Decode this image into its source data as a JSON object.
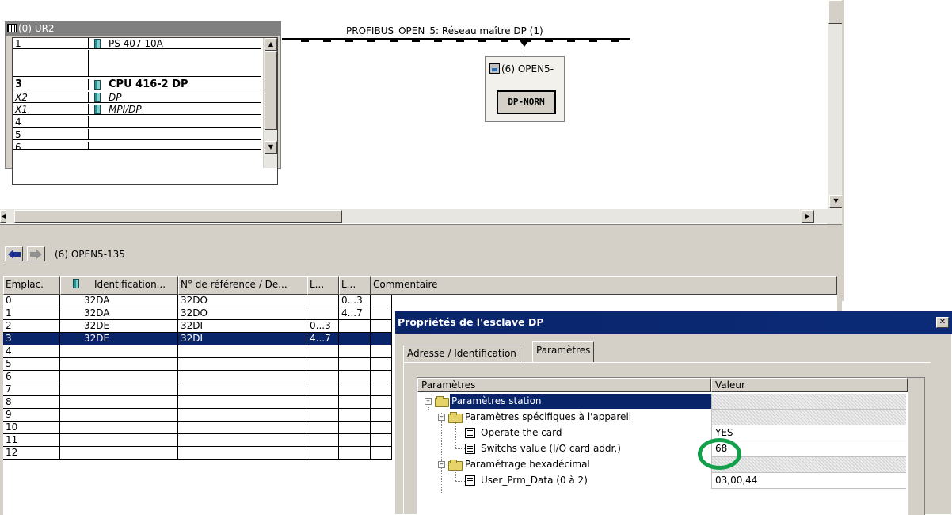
{
  "rack": {
    "title": "(0) UR2",
    "rows": [
      {
        "slot": "1",
        "module": "PS 407 10A",
        "style": "normal"
      },
      {
        "slot": "",
        "module": "",
        "style": "normal"
      },
      {
        "slot": "3",
        "module": "CPU 416-2 DP",
        "style": "bold"
      },
      {
        "slot": "X2",
        "module": "DP",
        "style": "italic"
      },
      {
        "slot": "X1",
        "module": "MPI/DP",
        "style": "italic"
      },
      {
        "slot": "4",
        "module": "",
        "style": "normal"
      },
      {
        "slot": "5",
        "module": "",
        "style": "normal"
      },
      {
        "slot": "6",
        "module": "",
        "style": "normal"
      }
    ]
  },
  "network": {
    "bus_label": "PROFIBUS_OPEN_5: Réseau maître DP (1)",
    "slave_label": "(6) OPEN5-",
    "slave_button": "DP-NORM"
  },
  "detail": {
    "station_label": "(6)  OPEN5-135",
    "columns": [
      "Emplac.",
      "Identification...",
      "N° de référence / De...",
      "L...",
      "L...",
      "Commentaire"
    ],
    "rows": [
      {
        "slot": "0",
        "id": "32DA",
        "ref": "32DO",
        "l1": "",
        "l2": "0...3",
        "comment": ""
      },
      {
        "slot": "1",
        "id": "32DA",
        "ref": "32DO",
        "l1": "",
        "l2": "4...7",
        "comment": ""
      },
      {
        "slot": "2",
        "id": "32DE",
        "ref": "32DI",
        "l1": "0...3",
        "l2": "",
        "comment": ""
      },
      {
        "slot": "3",
        "id": "32DE",
        "ref": "32DI",
        "l1": "4...7",
        "l2": "",
        "comment": ""
      },
      {
        "slot": "4",
        "id": "",
        "ref": "",
        "l1": "",
        "l2": "",
        "comment": ""
      },
      {
        "slot": "5",
        "id": "",
        "ref": "",
        "l1": "",
        "l2": "",
        "comment": ""
      },
      {
        "slot": "6",
        "id": "",
        "ref": "",
        "l1": "",
        "l2": "",
        "comment": ""
      },
      {
        "slot": "7",
        "id": "",
        "ref": "",
        "l1": "",
        "l2": "",
        "comment": ""
      },
      {
        "slot": "8",
        "id": "",
        "ref": "",
        "l1": "",
        "l2": "",
        "comment": ""
      },
      {
        "slot": "9",
        "id": "",
        "ref": "",
        "l1": "",
        "l2": "",
        "comment": ""
      },
      {
        "slot": "10",
        "id": "",
        "ref": "",
        "l1": "",
        "l2": "",
        "comment": ""
      },
      {
        "slot": "11",
        "id": "",
        "ref": "",
        "l1": "",
        "l2": "",
        "comment": ""
      },
      {
        "slot": "12",
        "id": "",
        "ref": "",
        "l1": "",
        "l2": "",
        "comment": ""
      }
    ],
    "selected_row": 3
  },
  "dialog": {
    "title": "Propriétés de l'esclave DP",
    "close": "✕",
    "tabs": [
      "Adresse / Identification",
      "Paramètres"
    ],
    "active_tab": 1,
    "tree_header": {
      "name": "Paramètres",
      "value": "Valeur"
    },
    "tree": [
      {
        "label": "Paramètres station",
        "value": "",
        "type": "folder"
      },
      {
        "label": "Paramètres spécifiques à l'appareil",
        "value": "",
        "type": "folder"
      },
      {
        "label": "Operate the card",
        "value": "YES",
        "type": "param"
      },
      {
        "label": "Switchs value (I/O card addr.)",
        "value": "68",
        "type": "param"
      },
      {
        "label": "Paramétrage hexadécimal",
        "value": "",
        "type": "folder"
      },
      {
        "label": "User_Prm_Data (0 à 2)",
        "value": "03,00,44",
        "type": "param"
      }
    ]
  },
  "colors": {
    "selection": "#0a246a",
    "highlight_circle": "#12a14a",
    "face": "#d4d0c8"
  }
}
